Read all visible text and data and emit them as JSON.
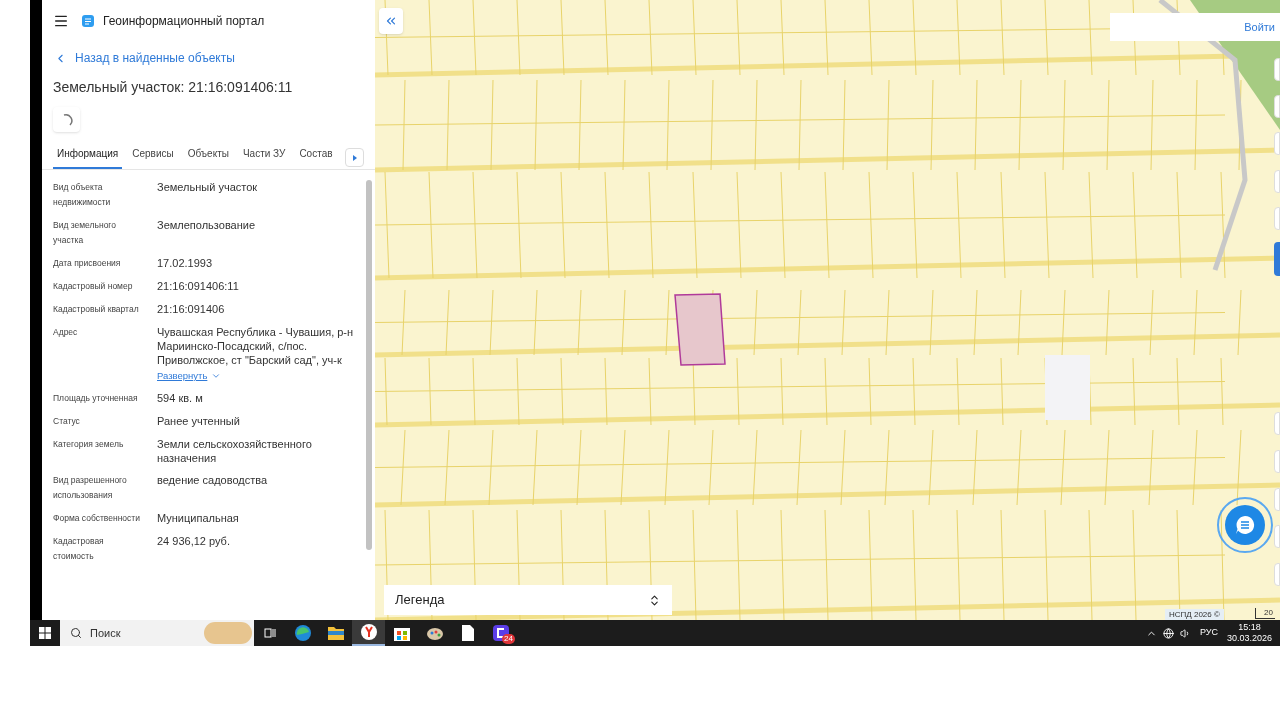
{
  "panel": {
    "title": "Геоинформационный портал",
    "back_link": "Назад в найденные объекты",
    "object_title": "Земельный участок: 21:16:091406:11",
    "tabs": [
      {
        "label": "Информация",
        "selected": true
      },
      {
        "label": "Сервисы",
        "selected": false
      },
      {
        "label": "Объекты",
        "selected": false
      },
      {
        "label": "Части ЗУ",
        "selected": false
      },
      {
        "label": "Состав",
        "selected": false
      }
    ],
    "fields": [
      {
        "label": "Вид объекта недвижимости",
        "value": "Земельный участок"
      },
      {
        "label": "Вид земельного участка",
        "value": "Землепользование"
      },
      {
        "label": "Дата присвоения",
        "value": "17.02.1993"
      },
      {
        "label": "Кадастровый номер",
        "value": "21:16:091406:11"
      },
      {
        "label": "Кадастровый квартал",
        "value": "21:16:091406"
      },
      {
        "label": "Адрес",
        "value": "Чувашская Республика - Чувашия, р-н Мариинско-Посадский, с/пос. Приволжское, ст \"Барский сад\", уч-к",
        "expand_link": "Развернуть"
      },
      {
        "label": "Площадь уточненная",
        "value": "594 кв. м"
      },
      {
        "label": "Статус",
        "value": "Ранее учтенный"
      },
      {
        "label": "Категория земель",
        "value": "Земли сельскохозяйственного назначения"
      },
      {
        "label": "Вид разрешенного использования",
        "value": "ведение садоводства"
      },
      {
        "label": "Форма собственности",
        "value": "Муниципальная"
      },
      {
        "label": "Кадастровая стоимость",
        "value": "24 936,12 руб."
      }
    ]
  },
  "map": {
    "login_button": "Войти",
    "legend": "Легенда",
    "attribution": "НСПД 2026 ©",
    "scale": "20"
  },
  "taskbar": {
    "search_placeholder": "Поиск",
    "apps": [
      {
        "kind": "edge",
        "selected": false
      },
      {
        "kind": "folder",
        "selected": false
      },
      {
        "kind": "browser",
        "selected": true
      },
      {
        "kind": "store",
        "selected": false
      },
      {
        "kind": "paint",
        "selected": false
      },
      {
        "kind": "file",
        "selected": false
      },
      {
        "kind": "messenger",
        "selected": false,
        "badge": "24"
      }
    ],
    "language": "РУС",
    "time": "15:18",
    "date": "30.03.2026"
  }
}
